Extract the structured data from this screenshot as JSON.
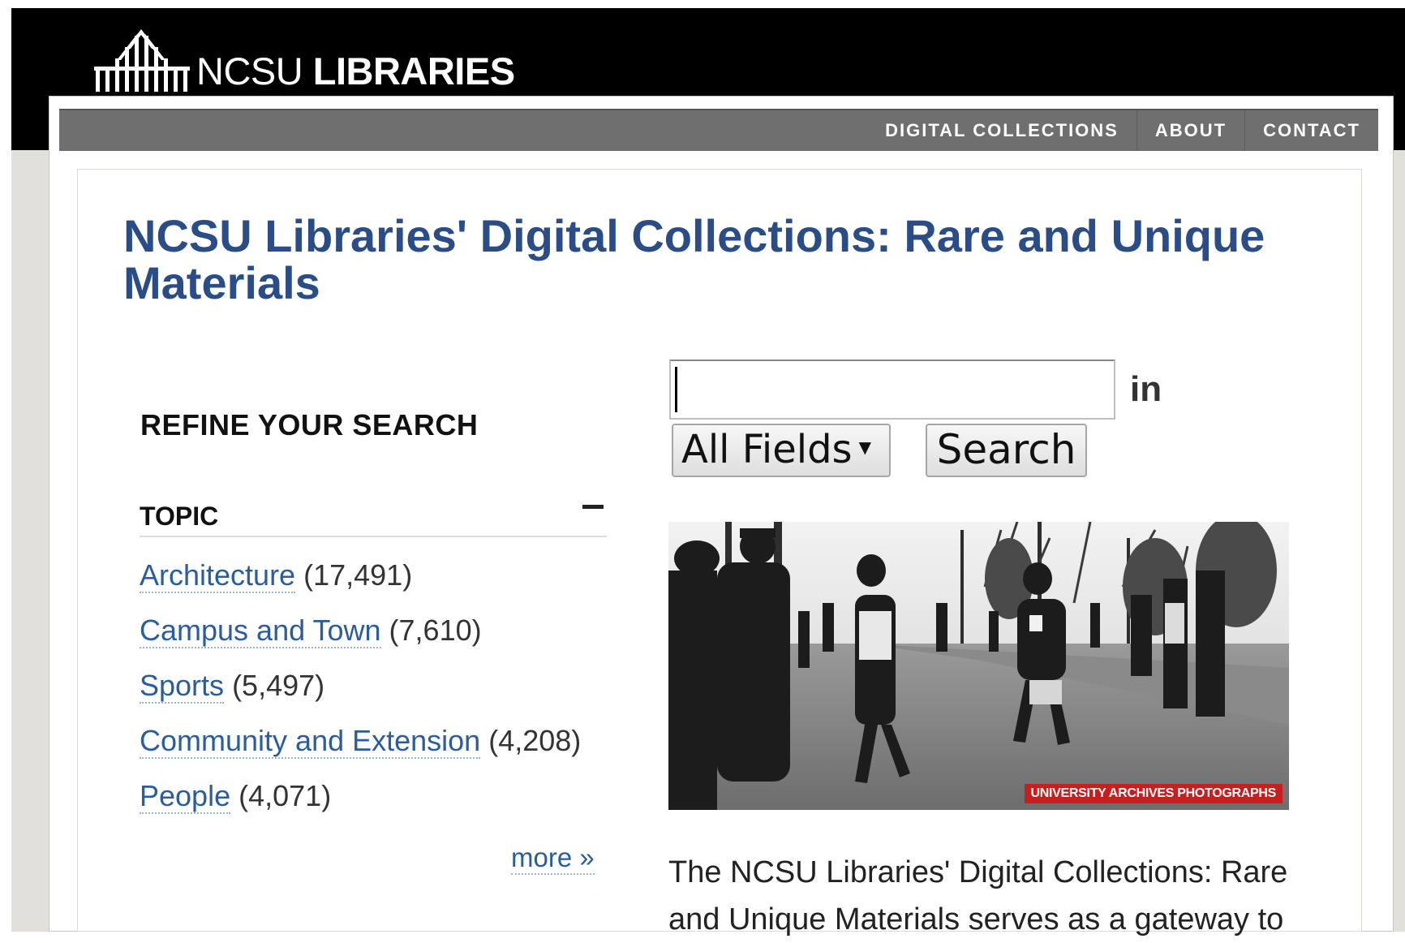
{
  "header": {
    "logo_icon": "ncsu-brick-tower-icon",
    "logo_text_regular": "NCSU",
    "logo_text_bold": "LIBRARIES"
  },
  "nav": {
    "items": [
      {
        "label": "DIGITAL COLLECTIONS"
      },
      {
        "label": "ABOUT"
      },
      {
        "label": "CONTACT"
      }
    ]
  },
  "main": {
    "title": "NCSU Libraries' Digital Collections: Rare and Unique Materials"
  },
  "sidebar": {
    "heading": "REFINE YOUR SEARCH",
    "topic_label": "TOPIC",
    "collapse_icon": "minus-icon",
    "facets": [
      {
        "name": "Architecture",
        "count": "(17,491)"
      },
      {
        "name": "Campus and Town",
        "count": "(7,610)"
      },
      {
        "name": "Sports",
        "count": "(5,497)"
      },
      {
        "name": "Community and Extension",
        "count": "(4,208)"
      },
      {
        "name": "People",
        "count": "(4,071)"
      }
    ],
    "more_label": "more »"
  },
  "search": {
    "value": "",
    "in_label": "in",
    "field_select": "All Fields",
    "button_label": "Search"
  },
  "feature": {
    "caption": "UNIVERSITY ARCHIVES PHOTOGRAPHS"
  },
  "description": "The NCSU Libraries' Digital Collections: Rare and Unique Materials serves as a gateway to",
  "colors": {
    "title_blue": "#2a4d87",
    "link_blue": "#2a5ca0",
    "navbar_gray": "#6f6f6f",
    "caption_red": "#c81e1e"
  }
}
